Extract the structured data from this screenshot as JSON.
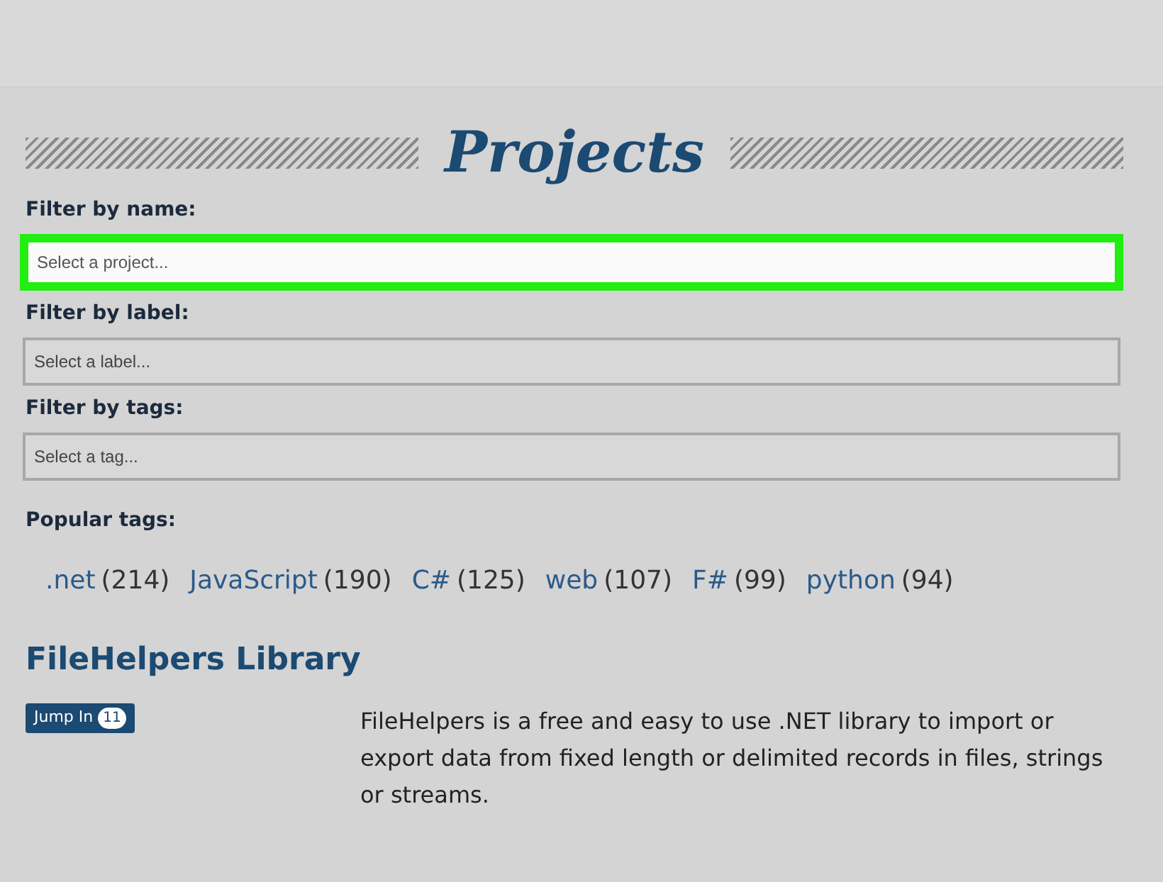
{
  "title": "Projects",
  "filters": [
    {
      "label": "Filter by name:",
      "placeholder": "Select a project...",
      "highlighted": true
    },
    {
      "label": "Filter by label:",
      "placeholder": "Select a label...",
      "highlighted": false
    },
    {
      "label": "Filter by tags:",
      "placeholder": "Select a tag...",
      "highlighted": false
    }
  ],
  "popular_tags": {
    "label": "Popular tags:",
    "tags": [
      {
        "name": ".net",
        "count": "(214)"
      },
      {
        "name": "JavaScript",
        "count": "(190)"
      },
      {
        "name": "C#",
        "count": "(125)"
      },
      {
        "name": "web",
        "count": "(107)"
      },
      {
        "name": "F#",
        "count": "(99)"
      },
      {
        "name": "python",
        "count": "(94)"
      }
    ]
  },
  "project": {
    "name": "FileHelpers Library",
    "button": "Jump In",
    "badge": "11",
    "description": "FileHelpers is a free and easy to use .NET library to import or export data from fixed length or delimited records in files, strings or streams."
  }
}
